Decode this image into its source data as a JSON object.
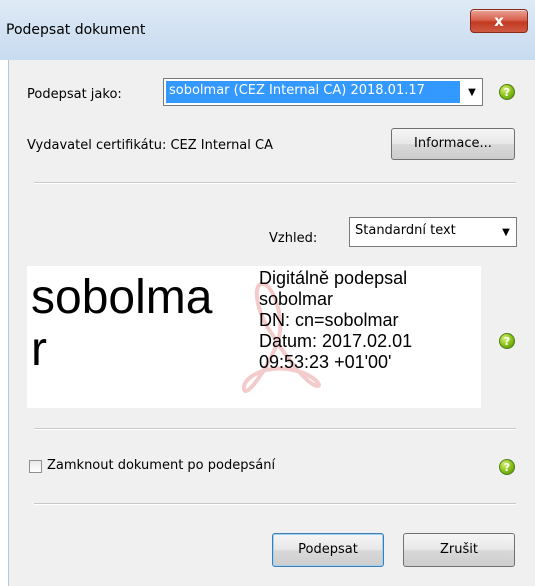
{
  "window": {
    "title": "Podepsat dokument",
    "close_label": "x"
  },
  "sign_as": {
    "label": "Podepsat jako:",
    "value": "sobolmar (CEZ Internal CA) 2018.01.17"
  },
  "issuer": {
    "text": "Vydavatel certifikátu: CEZ Internal CA",
    "info_button": "Informace..."
  },
  "appearance": {
    "label": "Vzhled:",
    "value": "Standardní text"
  },
  "preview": {
    "name_line1": "sobolma",
    "name_line2": "r",
    "lines": [
      "Digitálně podepsal",
      "sobolmar",
      "DN: cn=sobolmar",
      "Datum: 2017.02.01",
      "09:53:23 +01'00'"
    ]
  },
  "lock": {
    "label": "Zamknout dokument po podepsání",
    "checked": false
  },
  "buttons": {
    "sign": "Podepsat",
    "cancel": "Zrušit"
  },
  "icons": {
    "help": "help-icon",
    "dropdown": "chevron-down-icon",
    "logo": "acrobat-logo-icon"
  },
  "colors": {
    "selection": "#3399ff",
    "help_green": "#8cc21a",
    "close_red": "#c23a22",
    "logo": "#e9a0a0"
  }
}
